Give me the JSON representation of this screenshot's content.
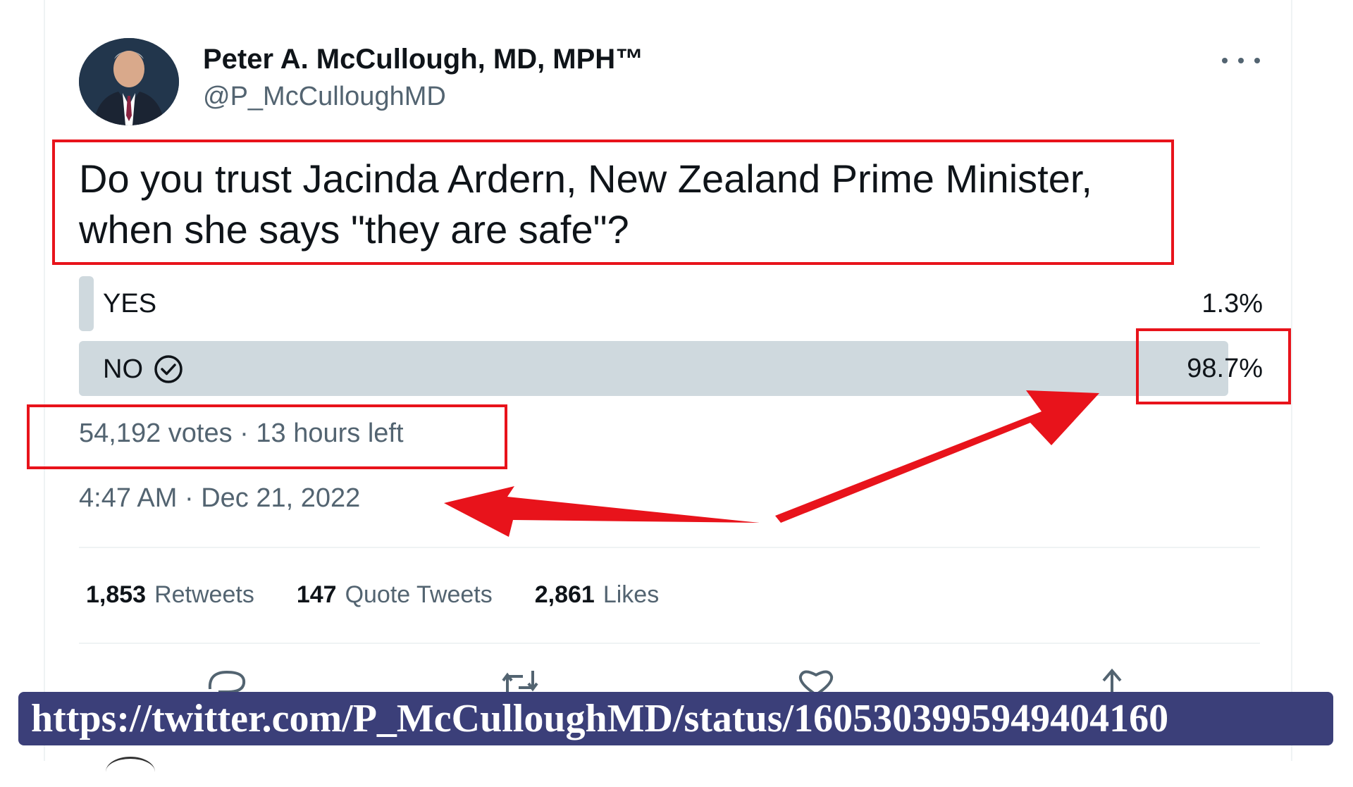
{
  "author": {
    "display_name": "Peter A. McCullough, MD, MPH™",
    "handle": "@P_McCulloughMD"
  },
  "tweet": {
    "text": "Do you trust Jacinda Ardern, New Zealand Prime Minister, when she says \"they are safe\"?"
  },
  "poll": {
    "options": [
      {
        "label": "YES",
        "percent_text": "1.3%",
        "percent": 1.3,
        "selected": false
      },
      {
        "label": "NO",
        "percent_text": "98.7%",
        "percent": 98.7,
        "selected": true
      }
    ],
    "meta": "54,192 votes · 13 hours left"
  },
  "timestamp": "4:47 AM · Dec 21, 2022",
  "stats": {
    "retweets_count": "1,853",
    "retweets_label": "Retweets",
    "quotes_count": "147",
    "quotes_label": "Quote Tweets",
    "likes_count": "2,861",
    "likes_label": "Likes"
  },
  "actions": [
    "reply-icon",
    "retweet-icon",
    "like-icon",
    "share-icon"
  ],
  "overlay": {
    "url": "https://twitter.com/P_McCulloughMD/status/1605303995949404160",
    "annotation_color": "#e8131b",
    "banner_color": "#3b3f79"
  }
}
